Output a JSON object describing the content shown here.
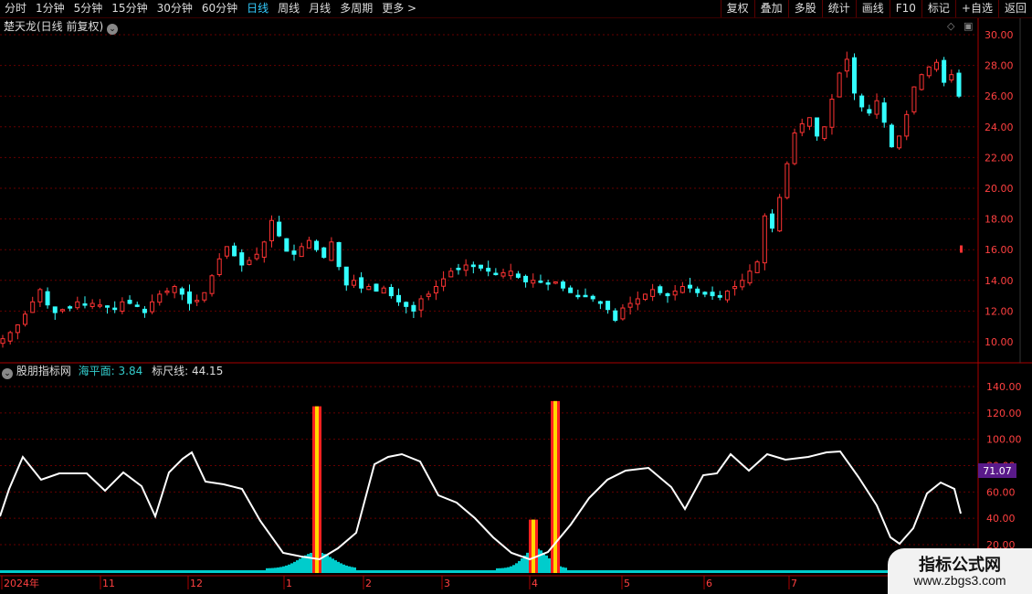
{
  "toolbar": {
    "periods": [
      "分时",
      "1分钟",
      "5分钟",
      "15分钟",
      "30分钟",
      "60分钟",
      "日线",
      "周线",
      "月线",
      "多周期",
      "更多 >"
    ],
    "active_period": "日线",
    "actions": [
      "复权",
      "叠加",
      "多股",
      "统计",
      "画线",
      "F10",
      "标记",
      "+自选",
      "返回"
    ]
  },
  "main_panel": {
    "stock_title": "楚天龙(日线 前复权)",
    "price_axis": [
      "30.00",
      "28.00",
      "26.00",
      "24.00",
      "22.00",
      "20.00",
      "18.00",
      "16.00",
      "14.00",
      "12.00",
      "10.00"
    ]
  },
  "indicator_panel": {
    "name": "股朋指标网",
    "haipingmian_label": "海平面:",
    "haipingmian_value": "3.84",
    "biaochixian_label": "标尺线:",
    "biaochixian_value": "44.15",
    "axis": [
      "140.00",
      "120.00",
      "100.00",
      "80.00",
      "60.00",
      "40.00",
      "20.00"
    ],
    "current_value": "71.07"
  },
  "time_axis": [
    "2024年",
    "11",
    "12",
    "1",
    "2",
    "3",
    "4",
    "5",
    "6",
    "7"
  ],
  "watermark": {
    "title": "指标公式网",
    "url": "www.zbgs3.com"
  },
  "colors": {
    "up": "#ff3333",
    "down": "#33ffff",
    "indicator_line": "#ffffff",
    "bar_fill": "#00cccc",
    "signal_outer": "#ff2020",
    "signal_inner": "#ffd700",
    "grid": "#660000",
    "value_badge": "#5a1a8a"
  },
  "chart_data": {
    "type": "line",
    "price_candles_approx": {
      "start": "2024-10",
      "end": "2024-08",
      "closes": [
        10.2,
        10.6,
        11.1,
        11.8,
        12.6,
        13.4,
        12.4,
        11.9,
        12.1,
        12.2,
        12.6,
        12.4,
        12.5,
        12.4,
        12.3,
        12.1,
        12.6,
        12.5,
        12.3,
        11.9,
        12.6,
        13.1,
        13.3,
        13.6,
        13.1,
        12.5,
        12.7,
        13.2,
        14.3,
        15.4,
        16.2,
        15.6,
        15.0,
        15.3,
        15.7,
        16.5,
        17.9,
        16.9,
        15.9,
        15.7,
        16.2,
        16.6,
        16.0,
        15.5,
        16.5,
        14.9,
        13.7,
        14.0,
        13.5,
        13.6,
        13.3,
        13.5,
        13.0,
        12.6,
        12.3,
        12.0,
        12.8,
        13.1,
        13.6,
        14.1,
        14.6,
        14.7,
        15.0,
        14.9,
        14.8,
        14.6,
        14.4,
        14.5,
        14.6,
        14.2,
        13.9,
        14.0,
        13.9,
        13.8,
        13.9,
        13.5,
        13.2,
        13.0,
        13.0,
        12.8,
        12.5,
        12.1,
        11.4,
        12.2,
        12.5,
        12.8,
        13.1,
        13.4,
        13.2,
        13.0,
        13.3,
        13.6,
        13.5,
        13.2,
        13.1,
        13.0,
        12.9,
        13.3,
        13.6,
        14.0,
        14.6,
        15.2,
        18.2,
        17.4,
        19.4,
        21.6,
        23.6,
        24.2,
        24.6,
        23.4,
        24.0,
        25.8,
        27.5,
        28.4,
        26.2,
        25.3,
        24.9,
        25.7,
        24.3,
        22.7,
        23.4,
        24.8,
        26.6,
        27.4,
        27.9,
        28.2,
        26.9,
        27.4,
        26.0
      ]
    },
    "indicator": {
      "haipingmian": 3.84,
      "biaochixian": 44.15,
      "current": 71.07,
      "yrange": [
        0,
        150
      ],
      "signal_bars": [
        {
          "month": "1",
          "height": 125
        },
        {
          "month": "4",
          "height": 39
        },
        {
          "month": "4",
          "height": 129
        }
      ]
    }
  }
}
